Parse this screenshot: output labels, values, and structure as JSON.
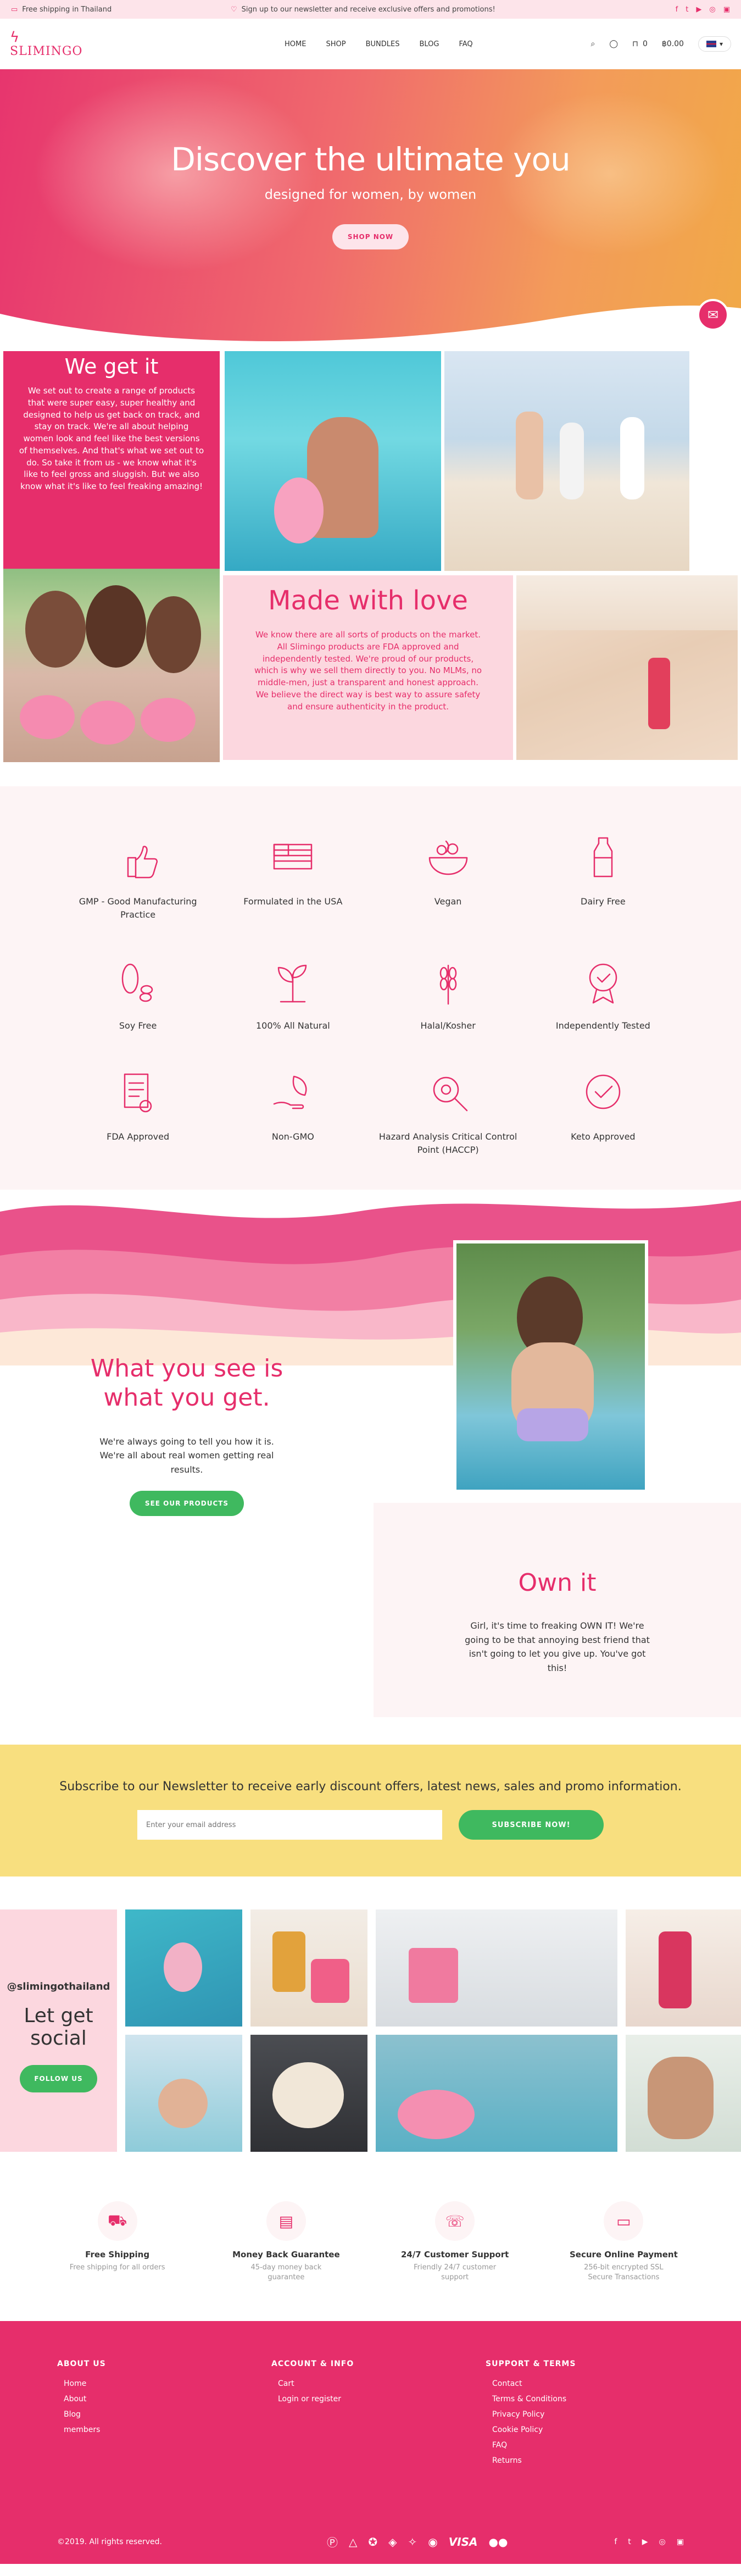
{
  "topbar": {
    "shipping": "Free shipping in Thailand",
    "promo": "Sign up to our newsletter and receive exclusive offers and promotions!",
    "socials": [
      "f",
      "t",
      "yt",
      "ig",
      "li"
    ]
  },
  "header": {
    "logo": "SLIMINGO",
    "nav": [
      "HOME",
      "SHOP",
      "BUNDLES",
      "BLOG",
      "FAQ"
    ],
    "cart_count": "0",
    "cart_total": "฿0.00"
  },
  "hero": {
    "title": "Discover the ultimate you",
    "subtitle": "designed for women, by women",
    "cta": "SHOP NOW"
  },
  "we_get_it": {
    "title": "We get it",
    "body": "We set out to create a range of products that were super easy, super healthy and designed to help us get back on track, and stay on track. We're all about helping women look and feel like the best versions of themselves. And that's what we set out to do. So take it from us - we know what it's like to feel gross and sluggish. But we also know what it's like to feel freaking amazing!"
  },
  "made_with_love": {
    "title": "Made with love",
    "body": "We know there are all sorts of products on the market. All Slimingo products are FDA approved and independently tested. We're proud of our products, which is why we sell them directly to you. No MLMs, no middle-men, just a transparent and honest approach. We believe the direct way is best way to assure safety and ensure authenticity in the product."
  },
  "features": [
    {
      "icon": "thumbs-up-icon",
      "label": "GMP - Good Manufacturing Practice"
    },
    {
      "icon": "us-flag-icon",
      "label": "Formulated in the USA"
    },
    {
      "icon": "salad-bowl-icon",
      "label": "Vegan"
    },
    {
      "icon": "milk-bottle-icon",
      "label": "Dairy Free"
    },
    {
      "icon": "soy-bean-icon",
      "label": "Soy Free"
    },
    {
      "icon": "plant-icon",
      "label": "100% All Natural"
    },
    {
      "icon": "wheat-icon",
      "label": "Halal/Kosher"
    },
    {
      "icon": "award-badge-icon",
      "label": "Independently Tested"
    },
    {
      "icon": "document-icon",
      "label": "FDA Approved"
    },
    {
      "icon": "hand-leaf-icon",
      "label": "Non-GMO"
    },
    {
      "icon": "magnifier-icon",
      "label": "Hazard Analysis Critical Control Point (HACCP)"
    },
    {
      "icon": "check-circle-icon",
      "label": "Keto Approved"
    }
  ],
  "what_you_see": {
    "title": "What you see is what you get.",
    "body": "We're always going to tell you how it is. We're all about real women getting real results.",
    "cta": "SEE OUR PRODUCTS"
  },
  "own_it": {
    "title": "Own it",
    "body": "Girl, it's time to freaking OWN IT! We're going to be that annoying best friend that isn't going to let you give up. You've got this!"
  },
  "newsletter": {
    "title": "Subscribe to our Newsletter to receive early discount offers, latest news, sales and promo information.",
    "placeholder": "Enter your email address",
    "cta": "SUBSCRIBE NOW!"
  },
  "social": {
    "handle": "@slimingothailand",
    "title": "Let get social",
    "cta": "FOLLOW US"
  },
  "benefits": [
    {
      "icon": "truck-icon",
      "title": "Free Shipping",
      "desc": "Free shipping for all orders"
    },
    {
      "icon": "money-icon",
      "title": "Money Back Guarantee",
      "desc": "45-day money back guarantee"
    },
    {
      "icon": "support-icon",
      "title": "24/7 Customer Support",
      "desc": "Friendly 24/7 customer support"
    },
    {
      "icon": "card-icon",
      "title": "Secure Online Payment",
      "desc": "256-bit encrypted SSL Secure Transactions"
    }
  ],
  "footer": {
    "about_title": "ABOUT US",
    "about_links": [
      "Home",
      "About",
      "Blog",
      "members"
    ],
    "account_title": "ACCOUNT & INFO",
    "account_links": [
      "Cart",
      "Login or register"
    ],
    "support_title": "SUPPORT & TERMS",
    "support_links": [
      "Contact",
      "Terms & Conditions",
      "Privacy Policy",
      "Cookie Policy",
      "FAQ",
      "Returns"
    ],
    "copyright": "©2019. All rights reserved.",
    "payment_visa": "VISA"
  },
  "colors": {
    "brand_pink": "#e62e6b",
    "light_pink": "#fcd7df",
    "green": "#3fb95f",
    "yellow": "#f8df7f"
  }
}
